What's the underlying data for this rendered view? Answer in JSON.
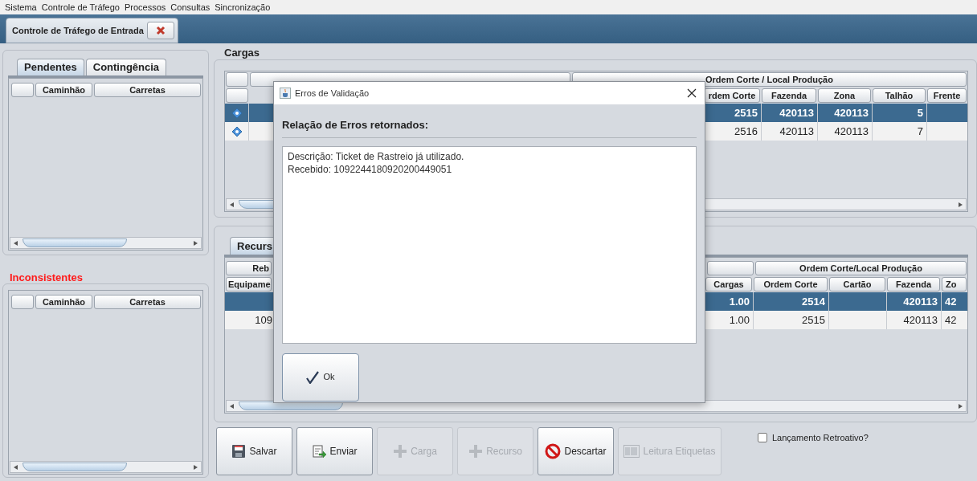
{
  "menu": [
    "Sistema",
    "Controle de Tráfego",
    "Processos",
    "Consultas",
    "Sincronização"
  ],
  "document_tabs": [
    {
      "label": "Controle de Tráfego de Entrada",
      "selected": true
    }
  ],
  "pendentes_panel": {
    "tabs": [
      {
        "label": "Pendentes",
        "selected": true
      },
      {
        "label": "Contingência",
        "selected": false
      }
    ],
    "columns": [
      "Caminhão",
      "Carretas"
    ]
  },
  "inconsistentes_panel": {
    "title": "Inconsistentes",
    "columns": [
      "Caminhão",
      "Carretas"
    ]
  },
  "cargas": {
    "title": "Cargas",
    "group_header": "Ordem Corte / Local Produção",
    "columns": [
      "rdem Corte",
      "Fazenda",
      "Zona",
      "Talhão",
      "Frente"
    ],
    "rows": [
      {
        "selected": true,
        "cells": [
          "2515",
          "420113",
          "420113",
          "5",
          null
        ]
      },
      {
        "selected": false,
        "cells": [
          "2516",
          "420113",
          "420113",
          "7",
          null
        ]
      }
    ]
  },
  "recursos": {
    "tabs": [
      {
        "label": "Recurs",
        "selected": true
      }
    ],
    "left_group_header": "Reb",
    "left_column": "Equipame",
    "group_header": "Ordem Corte/Local Produção",
    "columns": [
      "Cargas",
      "Ordem Corte",
      "Cartão",
      "Fazenda",
      "Zo"
    ],
    "rows": [
      {
        "selected": true,
        "cells": [
          "1.00",
          "2514",
          null,
          "420113",
          "42"
        ]
      },
      {
        "selected": false,
        "equipame": "109",
        "cells": [
          "1.00",
          "2515",
          null,
          "420113",
          "42"
        ]
      }
    ]
  },
  "buttons": [
    {
      "label": "Salvar",
      "kind": "save",
      "disabled": false
    },
    {
      "label": "Enviar",
      "kind": "send",
      "disabled": false
    },
    {
      "label": "Carga",
      "kind": "add",
      "disabled": true
    },
    {
      "label": "Recurso",
      "kind": "add",
      "disabled": true
    },
    {
      "label": "Descartar",
      "kind": "discard",
      "disabled": false
    },
    {
      "label": "Leitura Etiquetas",
      "kind": "barcode",
      "disabled": true
    }
  ],
  "checkbox": {
    "label": "Lançamento Retroativo?",
    "checked": false
  },
  "dialog": {
    "title": "Erros de Validação",
    "heading": "Relação de Erros retornados:",
    "lines": [
      "Descrição: Ticket de Rastreio já utilizado.",
      "Recebido: 1092244180920200449051"
    ],
    "button": "Ok"
  }
}
